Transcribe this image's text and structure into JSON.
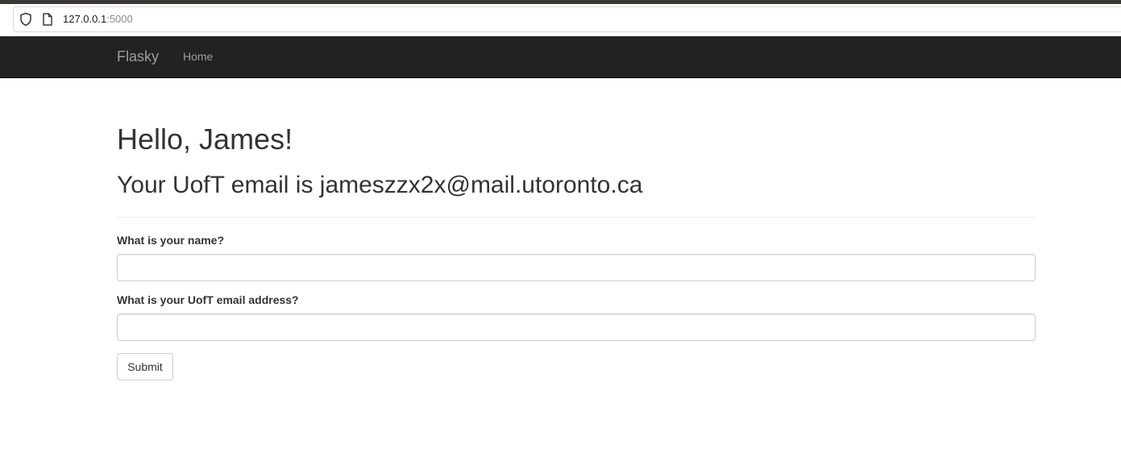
{
  "browser": {
    "url_host": "127.0.0.1",
    "url_port": ":5000",
    "icons": [
      "shield-icon",
      "page-icon"
    ]
  },
  "navbar": {
    "brand": "Flasky",
    "links": [
      {
        "label": "Home"
      }
    ]
  },
  "main": {
    "greeting": "Hello, James!",
    "email_line": "Your UofT email is jameszzx2x@mail.utoronto.ca",
    "form": {
      "name_label": "What is your name?",
      "name_value": "",
      "email_label": "What is your UofT email address?",
      "email_value": "",
      "submit_label": "Submit"
    }
  },
  "colors": {
    "navbar_bg": "#222222",
    "navbar_text": "#9d9d9d",
    "text": "#333333",
    "input_border": "#cccccc"
  }
}
